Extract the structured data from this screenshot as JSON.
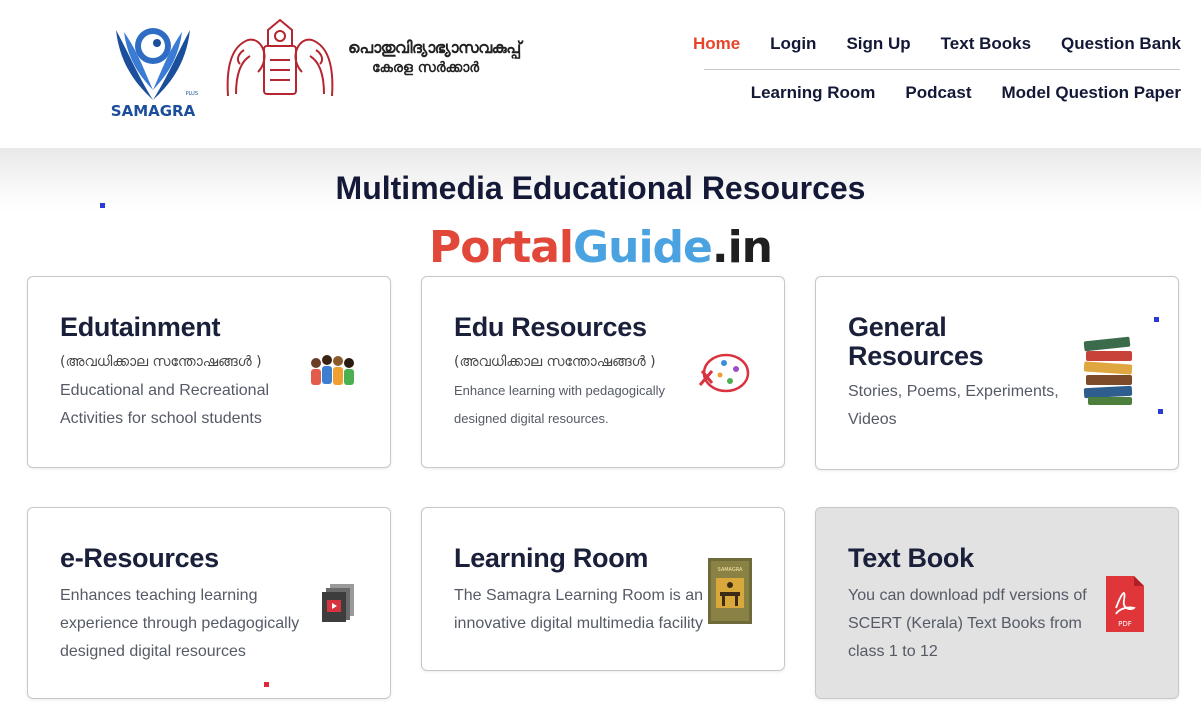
{
  "header": {
    "logo_text": "SAMAGRA",
    "logo_tagline": "PLUS",
    "dept_line1": "പൊതുവിദ്യാഭ്യാസവകുപ്പ്",
    "dept_line2": "കേരള സർക്കാർ",
    "nav_row1": [
      "Home",
      "Login",
      "Sign Up",
      "Text Books",
      "Question Bank"
    ],
    "nav_row2": [
      "Learning Room",
      "Podcast",
      "Model Question Paper"
    ],
    "active_color": "#e8442a"
  },
  "page_title": "Multimedia Educational Resources",
  "watermark": {
    "part1": "Portal",
    "part2": "Guide",
    "part3": ".in"
  },
  "cards": [
    {
      "title": "Edutainment",
      "subtitle": "(അവധിക്കാല സന്തോഷങ്ങൾ )",
      "description": [
        "Educational and Recreational",
        "Activities for school students"
      ],
      "icon": "children-group-icon"
    },
    {
      "title": "Edu Resources",
      "subtitle": "(അവധിക്കാല സന്തോഷങ്ങൾ )",
      "description": [
        "Enhance learning with pedagogically",
        "designed digital resources."
      ],
      "icon": "science-atom-icon"
    },
    {
      "title_lines": [
        "General",
        "Resources"
      ],
      "description": [
        "Stories, Poems, Experiments,",
        "Videos"
      ],
      "icon": "book-stack-icon"
    },
    {
      "title": "e-Resources",
      "description": [
        "Enhances teaching learning",
        "experience through pedagogically",
        "designed digital resources"
      ],
      "icon": "video-file-icon"
    },
    {
      "title": "Learning Room",
      "description": [
        "The Samagra Learning Room is an",
        "innovative digital multimedia facility"
      ],
      "icon": "learning-room-book-icon",
      "icon_text": "SAMAGRA"
    },
    {
      "title": "Text Book",
      "description": [
        "You can download pdf versions of",
        "SCERT (Kerala) Text Books from",
        "class 1 to 12"
      ],
      "icon": "pdf-file-icon",
      "icon_text": "PDF"
    }
  ]
}
